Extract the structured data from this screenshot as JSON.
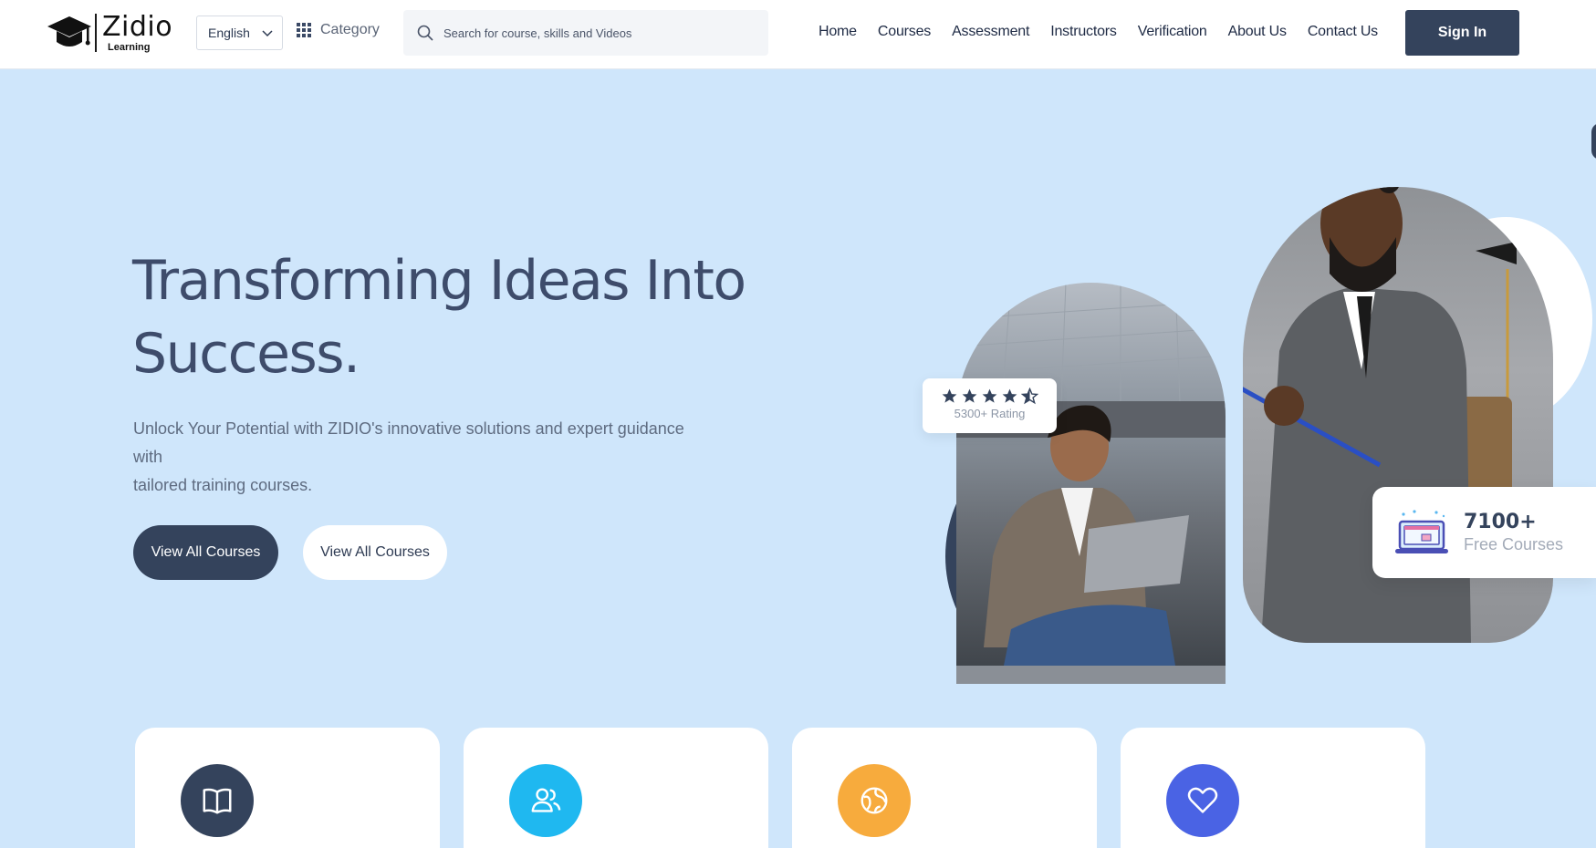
{
  "header": {
    "logo_main": "Zidio",
    "logo_sub": "Learning",
    "language": "English",
    "category_label": "Category",
    "search_placeholder": "Search for course, skills and Videos",
    "nav": [
      "Home",
      "Courses",
      "Assessment",
      "Instructors",
      "Verification",
      "About Us",
      "Contact Us"
    ],
    "signin_label": "Sign In"
  },
  "hero": {
    "title_line1": "Transforming Ideas Into",
    "title_line2": "Success.",
    "description_line1": "Unlock Your Potential with ZIDIO's innovative solutions and expert guidance with",
    "description_line2": "tailored training courses.",
    "primary_button": "View All Courses",
    "secondary_button": "View All Courses"
  },
  "rating_card": {
    "stars": 4.5,
    "label": "5300+ Rating"
  },
  "courses_card": {
    "count": "7100+",
    "label": "Free Courses"
  },
  "features": [
    {
      "icon": "book-open-icon",
      "color": "#34435c"
    },
    {
      "icon": "users-icon",
      "color": "#1fb8f0"
    },
    {
      "icon": "globe-icon",
      "color": "#f7ab3d"
    },
    {
      "icon": "heart-icon",
      "color": "#4a63e4"
    }
  ],
  "colors": {
    "primary": "#34435c",
    "hero_bg": "#cfe6fb",
    "text_heading": "#3e4c6b"
  }
}
